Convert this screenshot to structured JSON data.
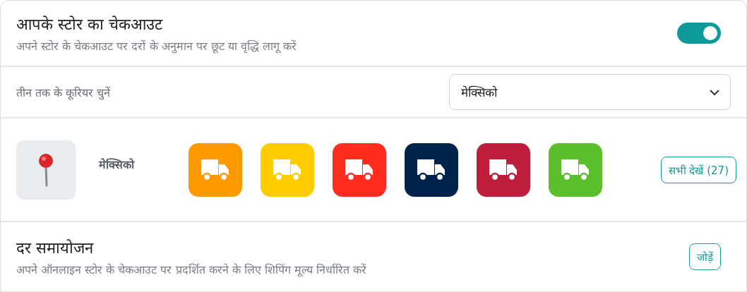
{
  "checkout": {
    "title": "आपके स्टोर का चेकआउट",
    "description": "अपने स्टोर के चेकआउट पर दरों के अनुमान पर छूट या वृद्धि लागू करें",
    "enabled": true
  },
  "courier_select": {
    "label": "तीन तक के कूरियर चुनें",
    "value": "मेक्सिको"
  },
  "courier_row": {
    "location": "मेक्सिको",
    "couriers": [
      {
        "color": "#ff9900"
      },
      {
        "color": "#ffcc00"
      },
      {
        "color": "#ff2d20"
      },
      {
        "color": "#00234b"
      },
      {
        "color": "#be1e3c"
      },
      {
        "color": "#5bbf2d"
      }
    ],
    "view_all": "सभी देखें (27)"
  },
  "rate_adjustment": {
    "title": "दर समायोजन",
    "description": "अपने ऑनलाइन स्टोर के चेकआउट पर प्रदर्शित करने के लिए शिपिंग मूल्य निर्धारित करें",
    "button": "जोड़ें"
  }
}
